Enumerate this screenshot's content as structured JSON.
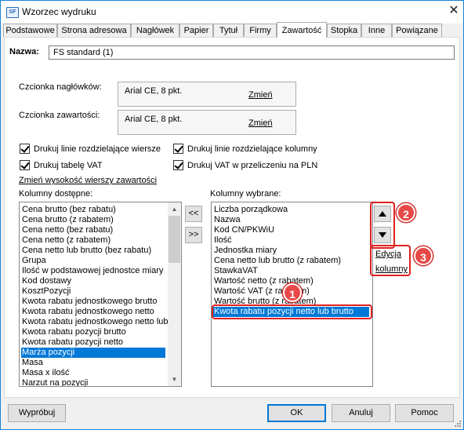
{
  "window": {
    "title": "Wzorzec wydruku",
    "icon_text": "SF"
  },
  "tabs": [
    {
      "label": "Podstawowe"
    },
    {
      "label": "Strona adresowa"
    },
    {
      "label": "Nagłówek"
    },
    {
      "label": "Papier"
    },
    {
      "label": "Tytuł"
    },
    {
      "label": "Firmy"
    },
    {
      "label": "Zawartość"
    },
    {
      "label": "Stopka"
    },
    {
      "label": "Inne"
    },
    {
      "label": "Powiązane"
    }
  ],
  "name": {
    "label": "Nazwa:",
    "value": "FS standard (1)"
  },
  "fonts": {
    "header_label": "Czcionka nagłówków:",
    "header_value": "Arial CE, 8 pkt.",
    "content_label": "Czcionka zawartości:",
    "content_value": "Arial CE, 8 pkt.",
    "change_label": "Zmień"
  },
  "checkboxes": {
    "row_lines": "Drukuj linie rozdzielające wiersze",
    "col_lines": "Drukuj linie rozdzielające kolumny",
    "vat_table": "Drukuj tabelę VAT",
    "vat_pln": "Drukuj VAT w przeliczeniu na PLN"
  },
  "row_height_link": "Zmień wysokość wierszy zawartości",
  "available": {
    "label": "Kolumny dostępne:",
    "items": [
      "Cena brutto (bez rabatu)",
      "Cena brutto (z rabatem)",
      "Cena netto (bez rabatu)",
      "Cena netto (z rabatem)",
      "Cena netto lub brutto (bez rabatu)",
      "Grupa",
      "Ilość w podstawowej jednostce miary",
      "Kod dostawy",
      "KosztPozycji",
      "Kwota rabatu jednostkowego brutto",
      "Kwota rabatu jednostkowego netto",
      "Kwota rabatu jednostkowego netto lub",
      "Kwota rabatu pozycji brutto",
      "Kwota rabatu pozycji netto",
      "Marża pozycji",
      "Masa",
      "Masa x ilość",
      "Narzut na pozycji"
    ],
    "selected_index": 14
  },
  "move_buttons": {
    "left": "<<",
    "right": ">>"
  },
  "chosen": {
    "label": "Kolumny wybrane:",
    "items": [
      "Liczba porządkowa",
      "Nazwa",
      "Kod CN/PKWiU",
      "Ilość",
      "Jednostka miary",
      "Cena netto lub brutto (z rabatem)",
      "StawkaVAT",
      "Wartość netto (z rabatem)",
      "Wartość VAT (z rabatem)",
      "Wartość brutto (z rabatem)",
      "Kwota rabatu pozycji netto lub brutto"
    ],
    "selected_index": 10
  },
  "edit_link": {
    "line1": "Edycja",
    "line2": "kolumny"
  },
  "callouts": {
    "one": "1",
    "two": "2",
    "three": "3"
  },
  "footer": {
    "preview": "Wypróbuj",
    "ok": "OK",
    "cancel": "Anuluj",
    "help": "Pomoc"
  },
  "colors": {
    "selection": "#0078d7",
    "callout": "#e84848",
    "accent": "#1883d7"
  }
}
